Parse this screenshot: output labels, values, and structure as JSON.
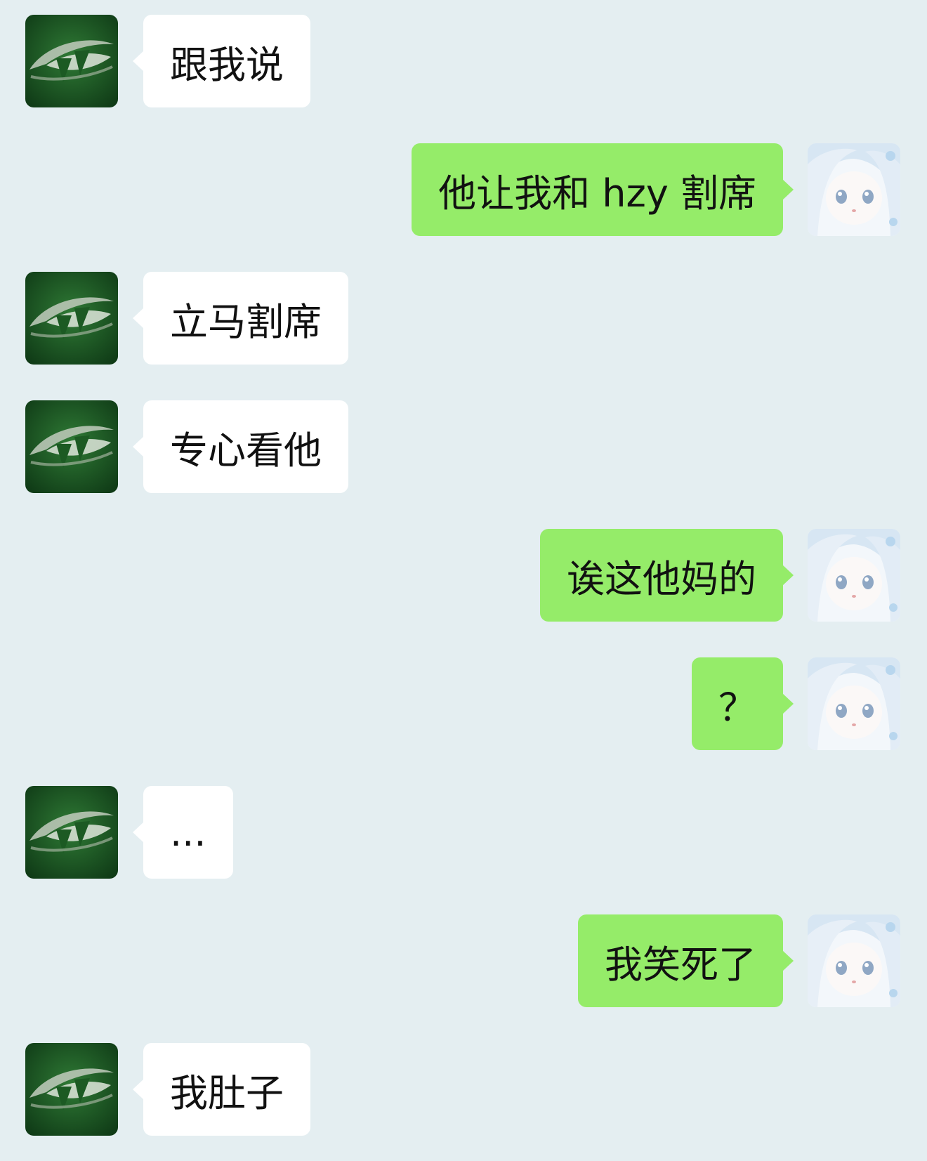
{
  "chat": {
    "messages": [
      {
        "side": "left",
        "text": "跟我说"
      },
      {
        "side": "right",
        "text": "他让我和 hzy 割席"
      },
      {
        "side": "left",
        "text": "立马割席"
      },
      {
        "side": "left",
        "text": "专心看他"
      },
      {
        "side": "right",
        "text": "诶这他妈的"
      },
      {
        "side": "right",
        "text": "？"
      },
      {
        "side": "left",
        "text": "..."
      },
      {
        "side": "right",
        "text": "我笑死了"
      },
      {
        "side": "left",
        "text": "我肚子"
      }
    ]
  },
  "avatars": {
    "contact": {
      "icon": "green-eye-avatar-icon"
    },
    "self": {
      "icon": "anime-girl-avatar-icon"
    }
  },
  "colors": {
    "background": "#e4eef1",
    "incoming_bubble": "#ffffff",
    "outgoing_bubble": "#95ec69",
    "text": "#111111"
  }
}
